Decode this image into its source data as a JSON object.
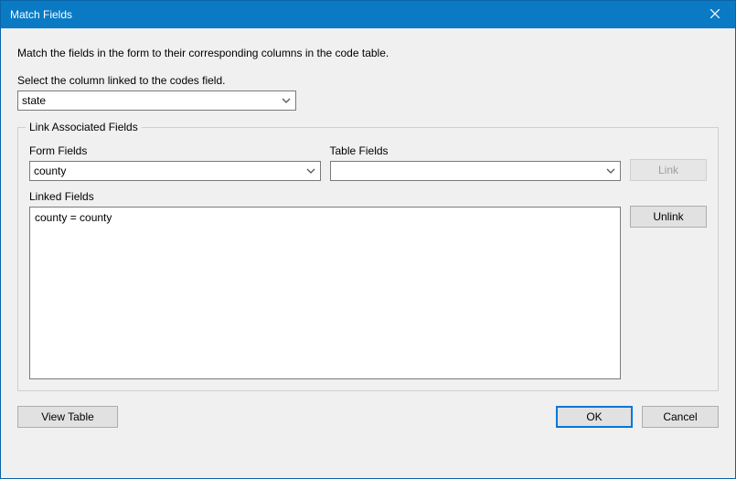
{
  "title": "Match Fields",
  "instruction": "Match the fields in the form to their corresponding columns in the code table.",
  "codes": {
    "label": "Select the column linked to the codes field.",
    "value": "state"
  },
  "group": {
    "title": "Link Associated Fields",
    "formFields": {
      "label": "Form Fields",
      "value": "county"
    },
    "tableFields": {
      "label": "Table Fields",
      "value": ""
    },
    "linkBtn": "Link",
    "linkedLabel": "Linked Fields",
    "linkedItems": [
      "county = county"
    ],
    "unlinkBtn": "Unlink"
  },
  "footer": {
    "viewTable": "View Table",
    "ok": "OK",
    "cancel": "Cancel"
  }
}
